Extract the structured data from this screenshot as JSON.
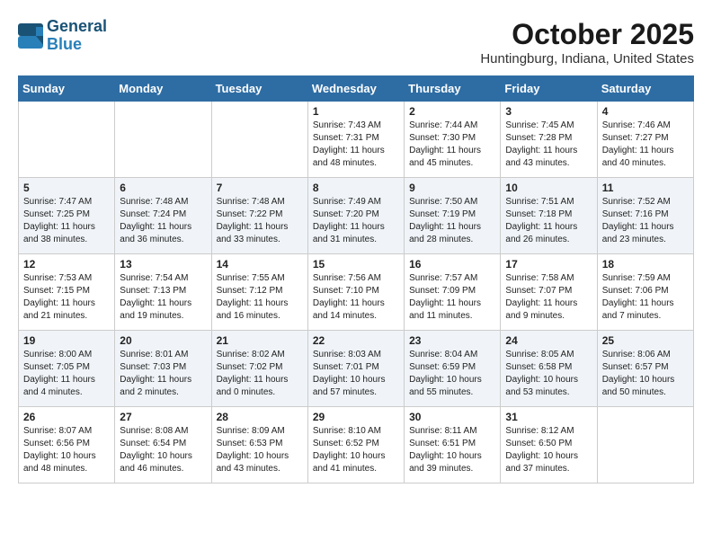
{
  "header": {
    "logo_line1": "General",
    "logo_line2": "Blue",
    "month": "October 2025",
    "location": "Huntingburg, Indiana, United States"
  },
  "weekdays": [
    "Sunday",
    "Monday",
    "Tuesday",
    "Wednesday",
    "Thursday",
    "Friday",
    "Saturday"
  ],
  "weeks": [
    [
      {
        "day": "",
        "sunrise": "",
        "sunset": "",
        "daylight": ""
      },
      {
        "day": "",
        "sunrise": "",
        "sunset": "",
        "daylight": ""
      },
      {
        "day": "",
        "sunrise": "",
        "sunset": "",
        "daylight": ""
      },
      {
        "day": "1",
        "sunrise": "Sunrise: 7:43 AM",
        "sunset": "Sunset: 7:31 PM",
        "daylight": "Daylight: 11 hours and 48 minutes."
      },
      {
        "day": "2",
        "sunrise": "Sunrise: 7:44 AM",
        "sunset": "Sunset: 7:30 PM",
        "daylight": "Daylight: 11 hours and 45 minutes."
      },
      {
        "day": "3",
        "sunrise": "Sunrise: 7:45 AM",
        "sunset": "Sunset: 7:28 PM",
        "daylight": "Daylight: 11 hours and 43 minutes."
      },
      {
        "day": "4",
        "sunrise": "Sunrise: 7:46 AM",
        "sunset": "Sunset: 7:27 PM",
        "daylight": "Daylight: 11 hours and 40 minutes."
      }
    ],
    [
      {
        "day": "5",
        "sunrise": "Sunrise: 7:47 AM",
        "sunset": "Sunset: 7:25 PM",
        "daylight": "Daylight: 11 hours and 38 minutes."
      },
      {
        "day": "6",
        "sunrise": "Sunrise: 7:48 AM",
        "sunset": "Sunset: 7:24 PM",
        "daylight": "Daylight: 11 hours and 36 minutes."
      },
      {
        "day": "7",
        "sunrise": "Sunrise: 7:48 AM",
        "sunset": "Sunset: 7:22 PM",
        "daylight": "Daylight: 11 hours and 33 minutes."
      },
      {
        "day": "8",
        "sunrise": "Sunrise: 7:49 AM",
        "sunset": "Sunset: 7:20 PM",
        "daylight": "Daylight: 11 hours and 31 minutes."
      },
      {
        "day": "9",
        "sunrise": "Sunrise: 7:50 AM",
        "sunset": "Sunset: 7:19 PM",
        "daylight": "Daylight: 11 hours and 28 minutes."
      },
      {
        "day": "10",
        "sunrise": "Sunrise: 7:51 AM",
        "sunset": "Sunset: 7:18 PM",
        "daylight": "Daylight: 11 hours and 26 minutes."
      },
      {
        "day": "11",
        "sunrise": "Sunrise: 7:52 AM",
        "sunset": "Sunset: 7:16 PM",
        "daylight": "Daylight: 11 hours and 23 minutes."
      }
    ],
    [
      {
        "day": "12",
        "sunrise": "Sunrise: 7:53 AM",
        "sunset": "Sunset: 7:15 PM",
        "daylight": "Daylight: 11 hours and 21 minutes."
      },
      {
        "day": "13",
        "sunrise": "Sunrise: 7:54 AM",
        "sunset": "Sunset: 7:13 PM",
        "daylight": "Daylight: 11 hours and 19 minutes."
      },
      {
        "day": "14",
        "sunrise": "Sunrise: 7:55 AM",
        "sunset": "Sunset: 7:12 PM",
        "daylight": "Daylight: 11 hours and 16 minutes."
      },
      {
        "day": "15",
        "sunrise": "Sunrise: 7:56 AM",
        "sunset": "Sunset: 7:10 PM",
        "daylight": "Daylight: 11 hours and 14 minutes."
      },
      {
        "day": "16",
        "sunrise": "Sunrise: 7:57 AM",
        "sunset": "Sunset: 7:09 PM",
        "daylight": "Daylight: 11 hours and 11 minutes."
      },
      {
        "day": "17",
        "sunrise": "Sunrise: 7:58 AM",
        "sunset": "Sunset: 7:07 PM",
        "daylight": "Daylight: 11 hours and 9 minutes."
      },
      {
        "day": "18",
        "sunrise": "Sunrise: 7:59 AM",
        "sunset": "Sunset: 7:06 PM",
        "daylight": "Daylight: 11 hours and 7 minutes."
      }
    ],
    [
      {
        "day": "19",
        "sunrise": "Sunrise: 8:00 AM",
        "sunset": "Sunset: 7:05 PM",
        "daylight": "Daylight: 11 hours and 4 minutes."
      },
      {
        "day": "20",
        "sunrise": "Sunrise: 8:01 AM",
        "sunset": "Sunset: 7:03 PM",
        "daylight": "Daylight: 11 hours and 2 minutes."
      },
      {
        "day": "21",
        "sunrise": "Sunrise: 8:02 AM",
        "sunset": "Sunset: 7:02 PM",
        "daylight": "Daylight: 11 hours and 0 minutes."
      },
      {
        "day": "22",
        "sunrise": "Sunrise: 8:03 AM",
        "sunset": "Sunset: 7:01 PM",
        "daylight": "Daylight: 10 hours and 57 minutes."
      },
      {
        "day": "23",
        "sunrise": "Sunrise: 8:04 AM",
        "sunset": "Sunset: 6:59 PM",
        "daylight": "Daylight: 10 hours and 55 minutes."
      },
      {
        "day": "24",
        "sunrise": "Sunrise: 8:05 AM",
        "sunset": "Sunset: 6:58 PM",
        "daylight": "Daylight: 10 hours and 53 minutes."
      },
      {
        "day": "25",
        "sunrise": "Sunrise: 8:06 AM",
        "sunset": "Sunset: 6:57 PM",
        "daylight": "Daylight: 10 hours and 50 minutes."
      }
    ],
    [
      {
        "day": "26",
        "sunrise": "Sunrise: 8:07 AM",
        "sunset": "Sunset: 6:56 PM",
        "daylight": "Daylight: 10 hours and 48 minutes."
      },
      {
        "day": "27",
        "sunrise": "Sunrise: 8:08 AM",
        "sunset": "Sunset: 6:54 PM",
        "daylight": "Daylight: 10 hours and 46 minutes."
      },
      {
        "day": "28",
        "sunrise": "Sunrise: 8:09 AM",
        "sunset": "Sunset: 6:53 PM",
        "daylight": "Daylight: 10 hours and 43 minutes."
      },
      {
        "day": "29",
        "sunrise": "Sunrise: 8:10 AM",
        "sunset": "Sunset: 6:52 PM",
        "daylight": "Daylight: 10 hours and 41 minutes."
      },
      {
        "day": "30",
        "sunrise": "Sunrise: 8:11 AM",
        "sunset": "Sunset: 6:51 PM",
        "daylight": "Daylight: 10 hours and 39 minutes."
      },
      {
        "day": "31",
        "sunrise": "Sunrise: 8:12 AM",
        "sunset": "Sunset: 6:50 PM",
        "daylight": "Daylight: 10 hours and 37 minutes."
      },
      {
        "day": "",
        "sunrise": "",
        "sunset": "",
        "daylight": ""
      }
    ]
  ]
}
